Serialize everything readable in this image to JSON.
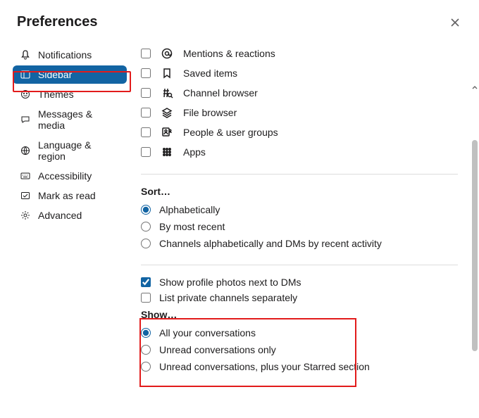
{
  "title": "Preferences",
  "sidebar": {
    "items": [
      {
        "label": "Notifications"
      },
      {
        "label": "Sidebar"
      },
      {
        "label": "Themes"
      },
      {
        "label": "Messages & media"
      },
      {
        "label": "Language & region"
      },
      {
        "label": "Accessibility"
      },
      {
        "label": "Mark as read"
      },
      {
        "label": "Advanced"
      }
    ]
  },
  "main": {
    "always_show": [
      {
        "label": "Mentions & reactions",
        "checked": false
      },
      {
        "label": "Saved items",
        "checked": false
      },
      {
        "label": "Channel browser",
        "checked": false
      },
      {
        "label": "File browser",
        "checked": false
      },
      {
        "label": "People & user groups",
        "checked": false
      },
      {
        "label": "Apps",
        "checked": false
      }
    ],
    "sort_heading": "Sort…",
    "sort_options": [
      {
        "label": "Alphabetically",
        "checked": true
      },
      {
        "label": "By most recent",
        "checked": false
      },
      {
        "label": "Channels alphabetically and DMs by recent activity",
        "checked": false
      }
    ],
    "toggles": [
      {
        "label": "Show profile photos next to DMs",
        "checked": true
      },
      {
        "label": "List private channels separately",
        "checked": false
      }
    ],
    "show_heading": "Show…",
    "show_options": [
      {
        "label": "All your conversations",
        "checked": true
      },
      {
        "label": "Unread conversations only",
        "checked": false
      },
      {
        "label": "Unread conversations, plus your Starred section",
        "checked": false
      }
    ]
  }
}
